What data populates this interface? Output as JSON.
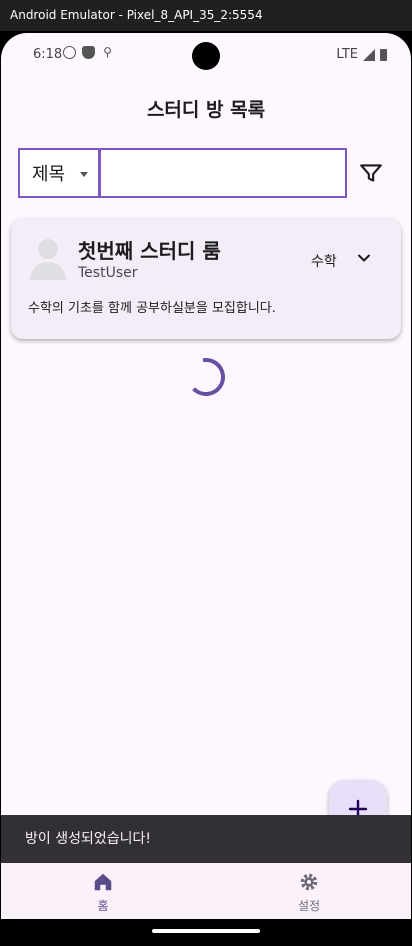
{
  "window": {
    "title": "Android Emulator - Pixel_8_API_35_2:5554"
  },
  "status_bar": {
    "time": "6:18",
    "network": "LTE"
  },
  "app_bar": {
    "title": "스터디 방 목록"
  },
  "search": {
    "field_selected": "제목",
    "value": "",
    "placeholder": ""
  },
  "rooms": [
    {
      "title": "첫번째 스터디 룸",
      "owner": "TestUser",
      "subject": "수학",
      "description": "수학의 기초를 함께 공부하실분을 모집합니다."
    }
  ],
  "snackbar": {
    "message": "방이 생성되었습니다!"
  },
  "bottom_nav": {
    "items": [
      {
        "label": "홈",
        "icon": "home-icon",
        "active": true
      },
      {
        "label": "설정",
        "icon": "gear-icon",
        "active": false
      }
    ]
  },
  "colors": {
    "accent": "#7e57c2",
    "card_bg": "#f3edf7",
    "screen_bg": "#fef7ff",
    "snackbar_bg": "#322f35",
    "fab_bg": "#e8def8"
  }
}
